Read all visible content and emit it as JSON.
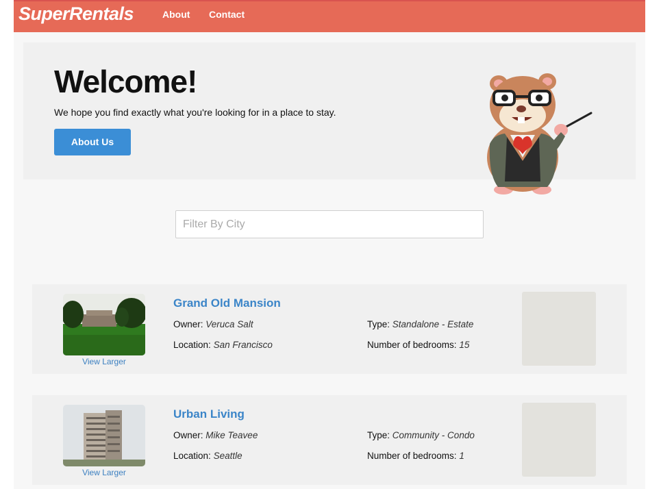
{
  "nav": {
    "brand": "SuperRentals",
    "about": "About",
    "contact": "Contact"
  },
  "jumbotron": {
    "title": "Welcome!",
    "tagline": "We hope you find exactly what you're looking for in a place to stay.",
    "button": "About Us"
  },
  "filter": {
    "placeholder": "Filter By City",
    "value": ""
  },
  "rentals": [
    {
      "title": "Grand Old Mansion",
      "owner_label": "Owner:",
      "owner": "Veruca Salt",
      "location_label": "Location:",
      "location": "San Francisco",
      "type_label": "Type:",
      "type": "Standalone - Estate",
      "bedrooms_label": "Number of bedrooms:",
      "bedrooms": "15",
      "view_larger": "View Larger"
    },
    {
      "title": "Urban Living",
      "owner_label": "Owner:",
      "owner": "Mike Teavee",
      "location_label": "Location:",
      "location": "Seattle",
      "type_label": "Type:",
      "type": "Community - Condo",
      "bedrooms_label": "Number of bedrooms:",
      "bedrooms": "1",
      "view_larger": "View Larger"
    }
  ],
  "colors": {
    "navbar": "#e66a57",
    "button": "#3b8ed6",
    "link": "#3b85c8"
  }
}
